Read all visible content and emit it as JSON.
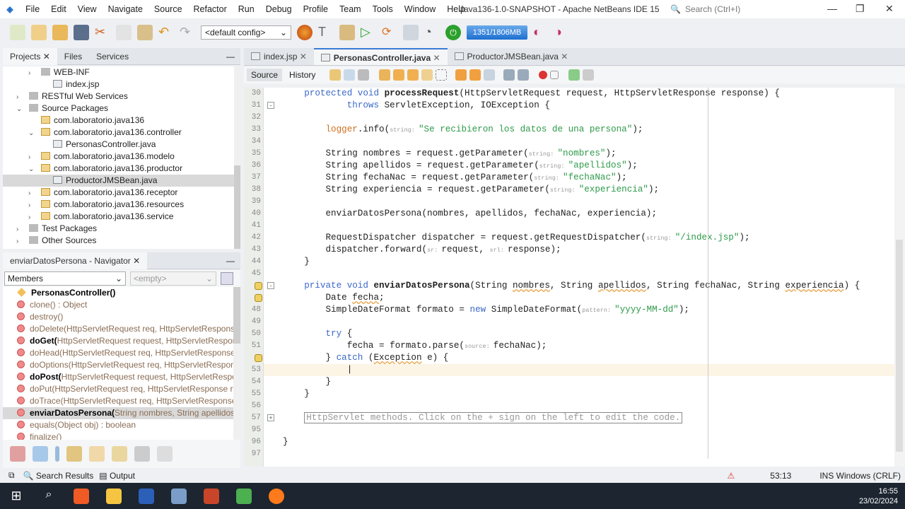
{
  "menu": [
    "File",
    "Edit",
    "View",
    "Navigate",
    "Source",
    "Refactor",
    "Run",
    "Debug",
    "Profile",
    "Team",
    "Tools",
    "Window",
    "Help"
  ],
  "title": "Java136-1.0-SNAPSHOT - Apache NetBeans IDE 15",
  "search_placeholder": "Search (Ctrl+I)",
  "toolbar": {
    "config": "<default config>",
    "memory": "1351/1806MB"
  },
  "projects_panel": {
    "tabs": [
      "Projects",
      "Files",
      "Services"
    ],
    "items": [
      {
        "label": "WEB-INF",
        "indent": 2,
        "icon": "folder",
        "arrow": "›"
      },
      {
        "label": "index.jsp",
        "indent": 3,
        "icon": "file"
      },
      {
        "label": "RESTful Web Services",
        "indent": 1,
        "icon": "folder",
        "arrow": "›"
      },
      {
        "label": "Source Packages",
        "indent": 1,
        "icon": "folder",
        "arrow": "⌄"
      },
      {
        "label": "com.laboratorio.java136",
        "indent": 2,
        "icon": "package"
      },
      {
        "label": "com.laboratorio.java136.controller",
        "indent": 2,
        "icon": "package",
        "arrow": "⌄"
      },
      {
        "label": "PersonasController.java",
        "indent": 3,
        "icon": "file"
      },
      {
        "label": "com.laboratorio.java136.modelo",
        "indent": 2,
        "icon": "package",
        "arrow": "›"
      },
      {
        "label": "com.laboratorio.java136.productor",
        "indent": 2,
        "icon": "package",
        "arrow": "⌄"
      },
      {
        "label": "ProductorJMSBean.java",
        "indent": 3,
        "icon": "file",
        "selected": true
      },
      {
        "label": "com.laboratorio.java136.receptor",
        "indent": 2,
        "icon": "package",
        "arrow": "›"
      },
      {
        "label": "com.laboratorio.java136.resources",
        "indent": 2,
        "icon": "package",
        "arrow": "›"
      },
      {
        "label": "com.laboratorio.java136.service",
        "indent": 2,
        "icon": "package",
        "arrow": "›"
      },
      {
        "label": "Test Packages",
        "indent": 1,
        "icon": "folder",
        "arrow": "›"
      },
      {
        "label": "Other Sources",
        "indent": 1,
        "icon": "folder",
        "arrow": "›"
      }
    ]
  },
  "navigator": {
    "title": "enviarDatosPersona - Navigator",
    "filter": "Members",
    "empty": "<empty>",
    "members": [
      {
        "name": "PersonasController()",
        "rest": "",
        "type": "constructor",
        "bold": true
      },
      {
        "name": "clone()",
        "rest": " : Object",
        "type": "method"
      },
      {
        "name": "destroy()",
        "rest": "",
        "type": "method"
      },
      {
        "name": "doDelete(",
        "rest": "HttpServletRequest req, HttpServletResponse resp)",
        "type": "method"
      },
      {
        "name": "doGet(",
        "rest": "HttpServletRequest request, HttpServletResponse response)",
        "type": "method",
        "bold": true
      },
      {
        "name": "doHead(",
        "rest": "HttpServletRequest req, HttpServletResponse resp)",
        "type": "method"
      },
      {
        "name": "doOptions(",
        "rest": "HttpServletRequest req, HttpServletResponse resp)",
        "type": "method"
      },
      {
        "name": "doPost(",
        "rest": "HttpServletRequest request, HttpServletResponse response)",
        "type": "method",
        "bold": true
      },
      {
        "name": "doPut(",
        "rest": "HttpServletRequest req, HttpServletResponse resp)",
        "type": "method"
      },
      {
        "name": "doTrace(",
        "rest": "HttpServletRequest req, HttpServletResponse resp)",
        "type": "method"
      },
      {
        "name": "enviarDatosPersona(",
        "rest": "String nombres, String apellidos, String fechaNac, String experiencia)",
        "type": "method",
        "bold": true,
        "selected": true
      },
      {
        "name": "equals(",
        "rest": "Object obj) : boolean",
        "type": "method"
      },
      {
        "name": "finalize()",
        "rest": "",
        "type": "method"
      }
    ]
  },
  "editor": {
    "tabs": [
      {
        "label": "index.jsp"
      },
      {
        "label": "PersonasController.java",
        "active": true
      },
      {
        "label": "ProductorJMSBean.java"
      }
    ],
    "source_label": "Source",
    "history_label": "History",
    "lines": [
      {
        "n": "30",
        "t": [
          [
            "",
            "    "
          ],
          [
            "k",
            "protected void "
          ],
          [
            "b",
            "processRequest"
          ],
          [
            "",
            "(HttpServletRequest request, HttpServletResponse response) {"
          ]
        ]
      },
      {
        "n": "31",
        "fold": "-",
        "t": [
          [
            "",
            "            "
          ],
          [
            "k",
            "throws"
          ],
          [
            "",
            " ServletException, IOException {"
          ]
        ]
      },
      {
        "n": "32",
        "t": []
      },
      {
        "n": "33",
        "t": [
          [
            "",
            "        "
          ],
          [
            "f",
            "logger"
          ],
          [
            "",
            ".info("
          ],
          [
            "h",
            "string: "
          ],
          [
            "s",
            "\"Se recibieron los datos de una persona\""
          ],
          [
            "",
            ");"
          ]
        ]
      },
      {
        "n": "34",
        "t": []
      },
      {
        "n": "35",
        "t": [
          [
            "",
            "        String nombres = request.getParameter("
          ],
          [
            "h",
            "string: "
          ],
          [
            "s",
            "\"nombres\""
          ],
          [
            "",
            ");"
          ]
        ]
      },
      {
        "n": "36",
        "t": [
          [
            "",
            "        String apellidos = request.getParameter("
          ],
          [
            "h",
            "string: "
          ],
          [
            "s",
            "\"apellidos\""
          ],
          [
            "",
            ");"
          ]
        ]
      },
      {
        "n": "37",
        "t": [
          [
            "",
            "        String fechaNac = request.getParameter("
          ],
          [
            "h",
            "string: "
          ],
          [
            "s",
            "\"fechaNac\""
          ],
          [
            "",
            ");"
          ]
        ]
      },
      {
        "n": "38",
        "t": [
          [
            "",
            "        String experiencia = request.getParameter("
          ],
          [
            "h",
            "string: "
          ],
          [
            "s",
            "\"experiencia\""
          ],
          [
            "",
            ");"
          ]
        ]
      },
      {
        "n": "39",
        "t": []
      },
      {
        "n": "40",
        "t": [
          [
            "",
            "        enviarDatosPersona(nombres, apellidos, fechaNac, experiencia);"
          ]
        ]
      },
      {
        "n": "41",
        "t": []
      },
      {
        "n": "42",
        "t": [
          [
            "",
            "        RequestDispatcher dispatcher = request.getRequestDispatcher("
          ],
          [
            "h",
            "string: "
          ],
          [
            "s",
            "\"/index.jsp\""
          ],
          [
            "",
            ");"
          ]
        ]
      },
      {
        "n": "43",
        "t": [
          [
            "",
            "        dispatcher.forward("
          ],
          [
            "h",
            "sr: "
          ],
          [
            "",
            "request, "
          ],
          [
            "h",
            "srl: "
          ],
          [
            "",
            "response);"
          ]
        ]
      },
      {
        "n": "44",
        "t": [
          [
            "",
            "    }"
          ]
        ]
      },
      {
        "n": "45",
        "t": []
      },
      {
        "n": "",
        "warn": true,
        "fold": "-",
        "t": [
          [
            "",
            "    "
          ],
          [
            "k",
            "private void "
          ],
          [
            "b",
            "enviarDatosPersona"
          ],
          [
            "",
            "(String "
          ],
          [
            "u",
            "nombres"
          ],
          [
            "",
            ", String "
          ],
          [
            "u",
            "apellidos"
          ],
          [
            "",
            ", String fechaNac, String "
          ],
          [
            "u",
            "experiencia"
          ],
          [
            "",
            ") {"
          ]
        ]
      },
      {
        "n": "",
        "warn": true,
        "t": [
          [
            "",
            "        Date "
          ],
          [
            "u",
            "fecha"
          ],
          [
            "",
            ";"
          ]
        ]
      },
      {
        "n": "48",
        "t": [
          [
            "",
            "        SimpleDateFormat formato = "
          ],
          [
            "k",
            "new"
          ],
          [
            "",
            " SimpleDateFormat("
          ],
          [
            "h",
            "pattern: "
          ],
          [
            "s",
            "\"yyyy-MM-dd\""
          ],
          [
            "",
            ");"
          ]
        ]
      },
      {
        "n": "49",
        "t": []
      },
      {
        "n": "50",
        "t": [
          [
            "",
            "        "
          ],
          [
            "k",
            "try"
          ],
          [
            "",
            " {"
          ]
        ]
      },
      {
        "n": "51",
        "t": [
          [
            "",
            "            fecha = formato.parse("
          ],
          [
            "h",
            "source: "
          ],
          [
            "",
            "fechaNac);"
          ]
        ]
      },
      {
        "n": "",
        "warn": true,
        "t": [
          [
            "",
            "        } "
          ],
          [
            "k",
            "catch"
          ],
          [
            "",
            " ("
          ],
          [
            "u",
            "Exception"
          ],
          [
            "",
            " e) {"
          ]
        ]
      },
      {
        "n": "53",
        "current": true,
        "t": [
          [
            "",
            "            |"
          ]
        ]
      },
      {
        "n": "54",
        "t": [
          [
            "",
            "        }"
          ]
        ]
      },
      {
        "n": "55",
        "t": [
          [
            "",
            "    }"
          ]
        ]
      },
      {
        "n": "56",
        "t": []
      },
      {
        "n": "57",
        "fold": "+",
        "t": [
          [
            "",
            "    "
          ],
          [
            "foldbox",
            "HttpServlet methods. Click on the + sign on the left to edit the code."
          ]
        ]
      },
      {
        "n": "95",
        "t": []
      },
      {
        "n": "96",
        "t": [
          [
            "",
            "}"
          ]
        ]
      },
      {
        "n": "97",
        "t": []
      }
    ]
  },
  "status": {
    "search_results": "Search Results",
    "output": "Output",
    "position": "53:13",
    "mode": "INS Windows (CRLF)"
  },
  "taskbar": {
    "time": "16:55",
    "date": "23/02/2024"
  }
}
